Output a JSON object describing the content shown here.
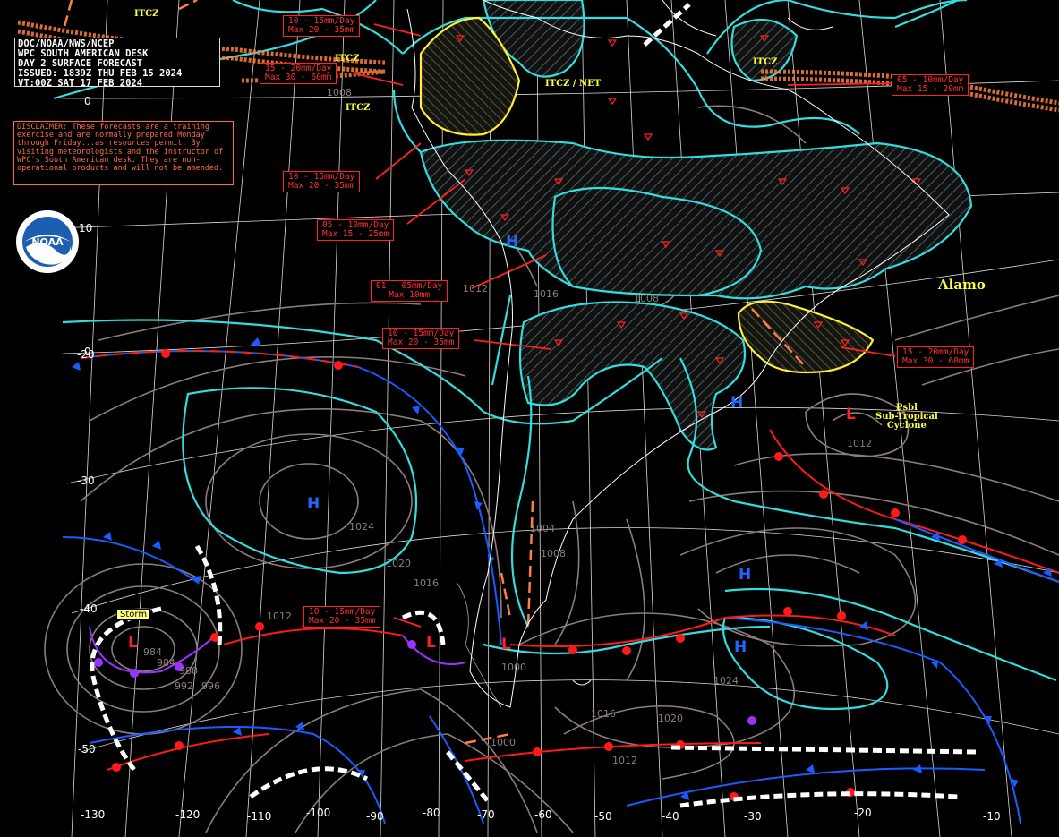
{
  "header": {
    "line1": "DOC/NOAA/NWS/NCEP",
    "line2": "WPC SOUTH AMERICAN DESK",
    "line3": "DAY 2 SURFACE FORECAST",
    "line4": "ISSUED: 1839Z THU FEB 15 2024",
    "line5": "VT:00Z SAT 17 FEB 2024"
  },
  "disclaimer": "DISCLAIMER: These forecasts are a training exercise and are normally prepared Monday through Friday...as resources permit.  By visiting meteorologists and the instructor of WPC's South American desk. They are non-operational products and will not be amended.",
  "logo_text": "NOAA",
  "precip_boxes": [
    {
      "l1": "10 - 15mm/Day",
      "l2": "Max 20 - 35mm"
    },
    {
      "l1": "15 - 20mm/Day",
      "l2": "Max 30 - 60mm"
    },
    {
      "l1": "10 - 15mm/Day",
      "l2": "Max 20 - 35mm"
    },
    {
      "l1": "05 - 10mm/Day",
      "l2": "Max 15 - 25mm"
    },
    {
      "l1": "01 - 05mm/Day",
      "l2": "Max 10mm"
    },
    {
      "l1": "10 - 15mm/Day",
      "l2": "Max 20 - 35mm"
    },
    {
      "l1": "10 - 15mm/Day",
      "l2": "Max 20 - 35mm"
    },
    {
      "l1": "05 - 10mm/Day",
      "l2": "Max 15 - 20mm"
    },
    {
      "l1": "15 - 20mm/Day",
      "l2": "Max 30 - 60mm"
    }
  ],
  "labels": {
    "itcz": "ITCZ",
    "itcz_net": "ITCZ / NET",
    "alamo": "Alamo",
    "subtropical_l1": "Psbl",
    "subtropical_l2": "Sub-Tropical",
    "subtropical_l3": "Cyclone",
    "storm": "Storm"
  },
  "latitudes": [
    "10",
    "0",
    "-20",
    "-30",
    "-40",
    "-50"
  ],
  "longitudes": [
    "-130",
    "-120",
    "-110",
    "-100",
    "-90",
    "-80",
    "-70",
    "-60",
    "-50",
    "-40",
    "-30",
    "-20",
    "-10"
  ],
  "isobar_labels": [
    "1008",
    "1012",
    "1016",
    "1008",
    "1024",
    "1020",
    "1016",
    "1012",
    "1004",
    "1008",
    "1000",
    "984",
    "988",
    "984",
    "992",
    "996",
    "1012",
    "1016",
    "1020",
    "1024",
    "1012",
    "1000"
  ],
  "pressure_centers": [
    {
      "type": "H",
      "color": "#2266ff"
    },
    {
      "type": "H",
      "color": "#2266ff"
    },
    {
      "type": "H",
      "color": "#2266ff"
    },
    {
      "type": "H",
      "color": "#2266ff"
    },
    {
      "type": "H",
      "color": "#2266ff"
    },
    {
      "type": "L",
      "color": "#ff2020"
    },
    {
      "type": "L",
      "color": "#ff2020"
    },
    {
      "type": "L",
      "color": "#ff2020"
    },
    {
      "type": "L",
      "color": "#ff2020"
    }
  ],
  "colors": {
    "background": "#000000",
    "precip_outline": "#33dddd",
    "heavy_outline": "#ffee33",
    "warm_front": "#ff1a1a",
    "cold_front": "#1a5cff",
    "occluded": "#9933ff",
    "isobar": "#8b7d7b",
    "itcz": "#ff7f3f",
    "coast": "#ffffff"
  }
}
